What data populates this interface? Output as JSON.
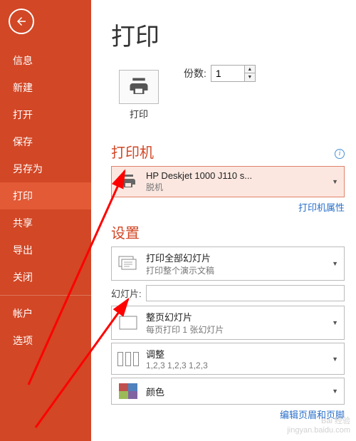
{
  "sidebar": {
    "items": [
      {
        "label": "信息"
      },
      {
        "label": "新建"
      },
      {
        "label": "打开"
      },
      {
        "label": "保存"
      },
      {
        "label": "另存为"
      },
      {
        "label": "打印"
      },
      {
        "label": "共享"
      },
      {
        "label": "导出"
      },
      {
        "label": "关闭"
      }
    ],
    "bottom": [
      {
        "label": "帐户"
      },
      {
        "label": "选项"
      }
    ]
  },
  "main": {
    "title": "打印",
    "print_label": "打印",
    "copies_label": "份数:",
    "copies_value": "1",
    "printer_section": "打印机",
    "printer_name": "HP Deskjet 1000 J110 s...",
    "printer_status": "脱机",
    "printer_props": "打印机属性",
    "settings_section": "设置",
    "range_title": "打印全部幻灯片",
    "range_sub": "打印整个演示文稿",
    "slides_label": "幻灯片:",
    "layout_title": "整页幻灯片",
    "layout_sub": "每页打印 1 张幻灯片",
    "collate_title": "调整",
    "collate_sub": "1,2,3    1,2,3    1,2,3",
    "color_title": "颜色",
    "edit_header_footer": "编辑页眉和页脚"
  },
  "watermark": {
    "l1": "Bai",
    "l2": "经验",
    "l3": "jingyan.baidu.com"
  }
}
